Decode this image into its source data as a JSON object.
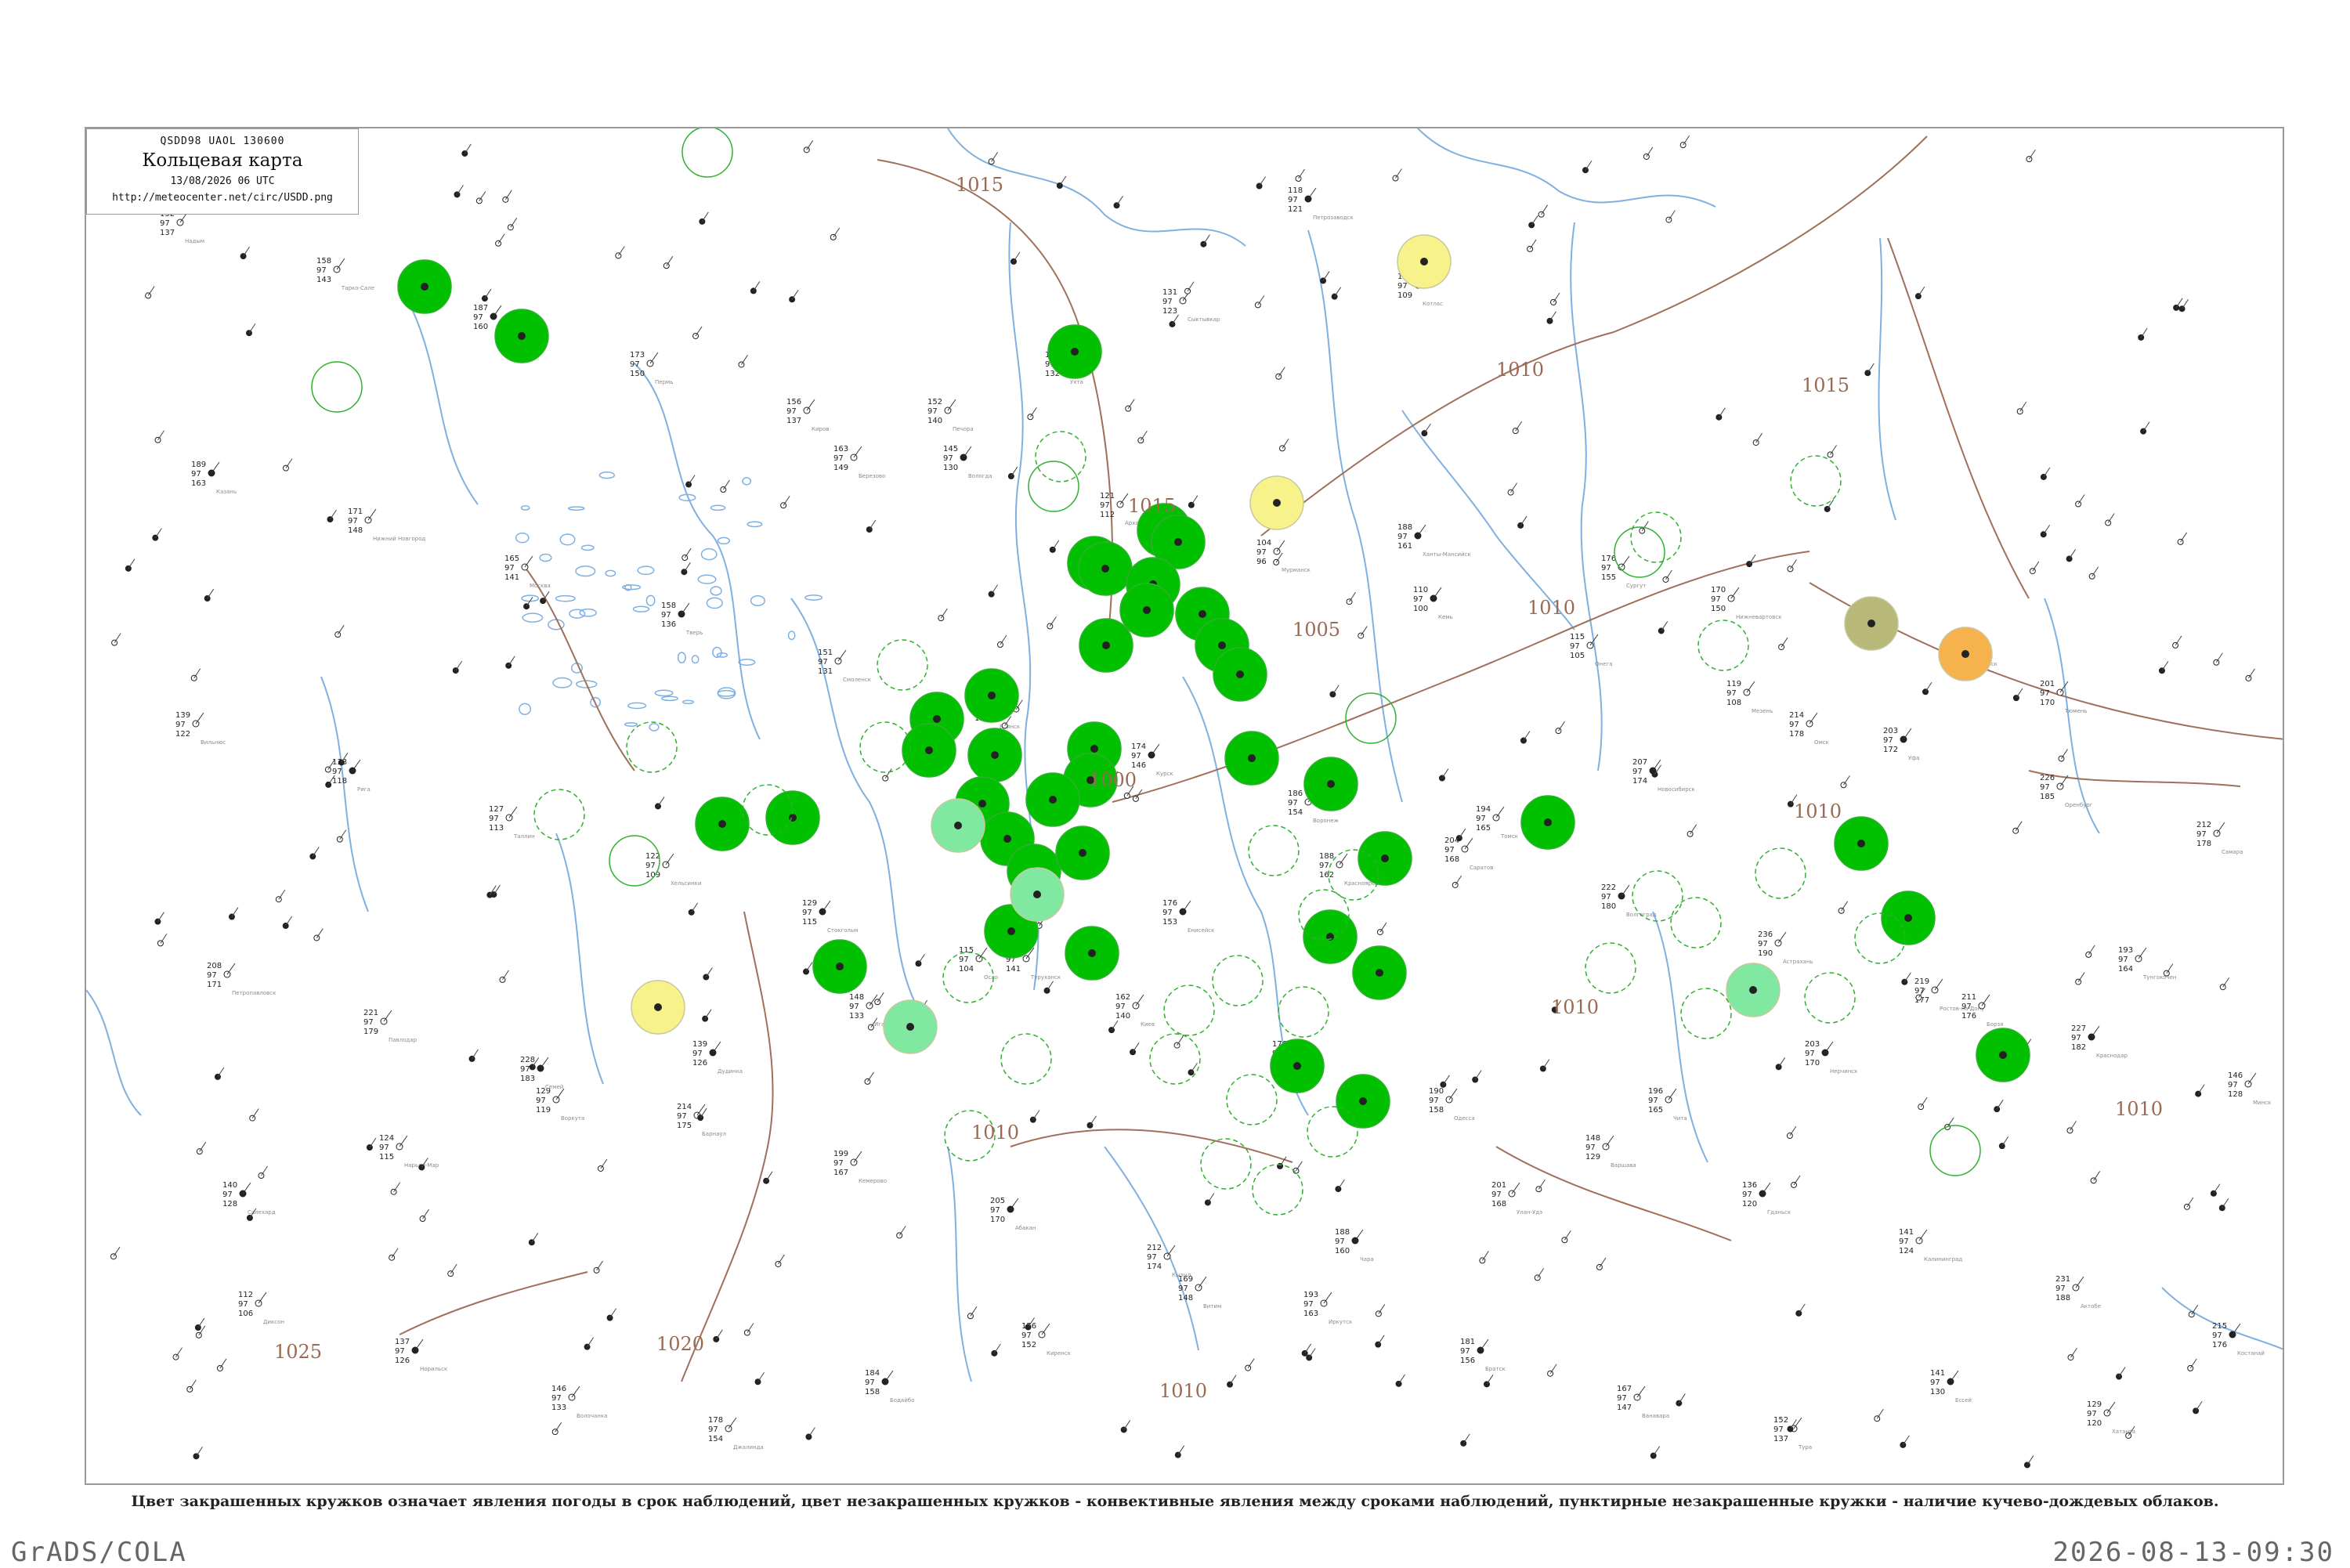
{
  "header": {
    "code": "QSDD98  UAOL  130600",
    "title": "Кольцевая карта",
    "date": "13/08/2026 06 UTC",
    "url": "http://meteocenter.net/circ/USDD.png"
  },
  "caption": "Цвет закрашенных кружков означает явления погоды в срок наблюдений, цвет незакрашенных кружков - конвективные явления между сроками наблюдений, пунктирные незакрашенные кружки - наличие кучево-дождевых облаков.",
  "footer": {
    "left": "GrADS/COLA",
    "right": "2026-08-13-09:30"
  },
  "colors": {
    "rain": "#00c000",
    "rain_light": "#80e8a0",
    "fog": "#f7f38a",
    "haze": "#b8b878",
    "dust": "#f6b24c",
    "isobar": "#a0705a",
    "river": "#7fb0e0",
    "outline": "#30b030"
  },
  "isobar_labels": [
    "1015",
    "1010",
    "1015",
    "1010",
    "1005",
    "1000",
    "1010",
    "1010",
    "1010",
    "1015",
    "1010",
    "1025",
    "1020",
    "1010"
  ],
  "stations": [
    {
      "name": "Петрозаводск",
      "values": [
        "118",
        "97",
        "121"
      ]
    },
    {
      "name": "Котлас",
      "values": [
        "127",
        "97",
        "109"
      ]
    },
    {
      "name": "Сыктывкар",
      "values": [
        "131",
        "97",
        "123"
      ]
    },
    {
      "name": "Ухта",
      "values": [
        "145",
        "97",
        "132"
      ]
    },
    {
      "name": "Печора",
      "values": [
        "152",
        "97",
        "140"
      ]
    },
    {
      "name": "Березово",
      "values": [
        "163",
        "97",
        "149"
      ]
    },
    {
      "name": "Ханты-Мансийск",
      "values": [
        "188",
        "97",
        "161"
      ]
    },
    {
      "name": "Сургут",
      "values": [
        "176",
        "97",
        "155"
      ]
    },
    {
      "name": "Нижневартовск",
      "values": [
        "170",
        "97",
        "150"
      ]
    },
    {
      "name": "Тобольск",
      "values": [
        "196",
        "97",
        "168"
      ]
    },
    {
      "name": "Тюмень",
      "values": [
        "201",
        "97",
        "170"
      ]
    },
    {
      "name": "Омск",
      "values": [
        "214",
        "97",
        "178"
      ]
    },
    {
      "name": "Новосибирск",
      "values": [
        "207",
        "97",
        "174"
      ]
    },
    {
      "name": "Томск",
      "values": [
        "194",
        "97",
        "165"
      ]
    },
    {
      "name": "Красноярск",
      "values": [
        "188",
        "97",
        "162"
      ]
    },
    {
      "name": "Енисейск",
      "values": [
        "176",
        "97",
        "153"
      ]
    },
    {
      "name": "Туруханск",
      "values": [
        "160",
        "97",
        "141"
      ]
    },
    {
      "name": "Игарка",
      "values": [
        "148",
        "97",
        "133"
      ]
    },
    {
      "name": "Дудинка",
      "values": [
        "139",
        "97",
        "126"
      ]
    },
    {
      "name": "Воркута",
      "values": [
        "129",
        "97",
        "119"
      ]
    },
    {
      "name": "Нарьян-Мар",
      "values": [
        "124",
        "97",
        "115"
      ]
    },
    {
      "name": "Салехард",
      "values": [
        "140",
        "97",
        "128"
      ]
    },
    {
      "name": "Надым",
      "values": [
        "152",
        "97",
        "137"
      ]
    },
    {
      "name": "Тарко-Сале",
      "values": [
        "158",
        "97",
        "143"
      ]
    },
    {
      "name": "Екатеринбург",
      "values": [
        "187",
        "97",
        "160"
      ]
    },
    {
      "name": "Пермь",
      "values": [
        "173",
        "97",
        "150"
      ]
    },
    {
      "name": "Киров",
      "values": [
        "156",
        "97",
        "137"
      ]
    },
    {
      "name": "Вологда",
      "values": [
        "145",
        "97",
        "130"
      ]
    },
    {
      "name": "Архангельск",
      "values": [
        "121",
        "97",
        "112"
      ]
    },
    {
      "name": "Мурманск",
      "values": [
        "104",
        "97",
        "96"
      ]
    },
    {
      "name": "Кемь",
      "values": [
        "110",
        "97",
        "100"
      ]
    },
    {
      "name": "Онега",
      "values": [
        "115",
        "97",
        "105"
      ]
    },
    {
      "name": "Мезень",
      "values": [
        "119",
        "97",
        "108"
      ]
    },
    {
      "name": "Уфа",
      "values": [
        "203",
        "97",
        "172"
      ]
    },
    {
      "name": "Оренбург",
      "values": [
        "226",
        "97",
        "185"
      ]
    },
    {
      "name": "Самара",
      "values": [
        "212",
        "97",
        "178"
      ]
    },
    {
      "name": "Казань",
      "values": [
        "189",
        "97",
        "163"
      ]
    },
    {
      "name": "Нижний Новгород",
      "values": [
        "171",
        "97",
        "148"
      ]
    },
    {
      "name": "Москва",
      "values": [
        "165",
        "97",
        "141"
      ]
    },
    {
      "name": "Тверь",
      "values": [
        "158",
        "97",
        "136"
      ]
    },
    {
      "name": "Смоленск",
      "values": [
        "151",
        "97",
        "131"
      ]
    },
    {
      "name": "Брянск",
      "values": [
        "163",
        "97",
        "139"
      ]
    },
    {
      "name": "Курск",
      "values": [
        "174",
        "97",
        "146"
      ]
    },
    {
      "name": "Воронеж",
      "values": [
        "186",
        "97",
        "154"
      ]
    },
    {
      "name": "Саратов",
      "values": [
        "204",
        "97",
        "168"
      ]
    },
    {
      "name": "Волгоград",
      "values": [
        "222",
        "97",
        "180"
      ]
    },
    {
      "name": "Астрахань",
      "values": [
        "236",
        "97",
        "190"
      ]
    },
    {
      "name": "Ростов-на-Дону",
      "values": [
        "219",
        "97",
        "177"
      ]
    },
    {
      "name": "Краснодар",
      "values": [
        "227",
        "97",
        "182"
      ]
    },
    {
      "name": "Минск",
      "values": [
        "146",
        "97",
        "128"
      ]
    },
    {
      "name": "Вильнюс",
      "values": [
        "139",
        "97",
        "122"
      ]
    },
    {
      "name": "Рига",
      "values": [
        "133",
        "97",
        "118"
      ]
    },
    {
      "name": "Таллин",
      "values": [
        "127",
        "97",
        "113"
      ]
    },
    {
      "name": "Хельсинки",
      "values": [
        "122",
        "97",
        "109"
      ]
    },
    {
      "name": "Стокгольм",
      "values": [
        "129",
        "97",
        "115"
      ]
    },
    {
      "name": "Осло",
      "values": [
        "115",
        "97",
        "104"
      ]
    },
    {
      "name": "Киев",
      "values": [
        "162",
        "97",
        "140"
      ]
    },
    {
      "name": "Харьков",
      "values": [
        "176",
        "97",
        "148"
      ]
    },
    {
      "name": "Одесса",
      "values": [
        "190",
        "97",
        "158"
      ]
    },
    {
      "name": "Варшава",
      "values": [
        "148",
        "97",
        "129"
      ]
    },
    {
      "name": "Гданьск",
      "values": [
        "136",
        "97",
        "120"
      ]
    },
    {
      "name": "Калининград",
      "values": [
        "141",
        "97",
        "124"
      ]
    },
    {
      "name": "Актобе",
      "values": [
        "231",
        "97",
        "188"
      ]
    },
    {
      "name": "Костанай",
      "values": [
        "215",
        "97",
        "176"
      ]
    },
    {
      "name": "Петропавловск",
      "values": [
        "208",
        "97",
        "171"
      ]
    },
    {
      "name": "Павлодар",
      "values": [
        "221",
        "97",
        "179"
      ]
    },
    {
      "name": "Семей",
      "values": [
        "228",
        "97",
        "183"
      ]
    },
    {
      "name": "Барнаул",
      "values": [
        "214",
        "97",
        "175"
      ]
    },
    {
      "name": "Кемерово",
      "values": [
        "199",
        "97",
        "167"
      ]
    },
    {
      "name": "Абакан",
      "values": [
        "205",
        "97",
        "170"
      ]
    },
    {
      "name": "Кызыл",
      "values": [
        "212",
        "97",
        "174"
      ]
    },
    {
      "name": "Иркутск",
      "values": [
        "193",
        "97",
        "163"
      ]
    },
    {
      "name": "Братск",
      "values": [
        "181",
        "97",
        "156"
      ]
    },
    {
      "name": "Ванавара",
      "values": [
        "167",
        "97",
        "147"
      ]
    },
    {
      "name": "Тура",
      "values": [
        "152",
        "97",
        "137"
      ]
    },
    {
      "name": "Ессей",
      "values": [
        "141",
        "97",
        "130"
      ]
    },
    {
      "name": "Хатанга",
      "values": [
        "129",
        "97",
        "120"
      ]
    },
    {
      "name": "Диксон",
      "values": [
        "112",
        "97",
        "106"
      ]
    },
    {
      "name": "Норильск",
      "values": [
        "137",
        "97",
        "126"
      ]
    },
    {
      "name": "Волочанка",
      "values": [
        "146",
        "97",
        "133"
      ]
    },
    {
      "name": "Джалинда",
      "values": [
        "178",
        "97",
        "154"
      ]
    },
    {
      "name": "Бодайбо",
      "values": [
        "184",
        "97",
        "158"
      ]
    },
    {
      "name": "Киренск",
      "values": [
        "176",
        "97",
        "152"
      ]
    },
    {
      "name": "Витим",
      "values": [
        "169",
        "97",
        "148"
      ]
    },
    {
      "name": "Чара",
      "values": [
        "188",
        "97",
        "160"
      ]
    },
    {
      "name": "Улан-Удэ",
      "values": [
        "201",
        "97",
        "168"
      ]
    },
    {
      "name": "Чита",
      "values": [
        "196",
        "97",
        "165"
      ]
    },
    {
      "name": "Нерчинск",
      "values": [
        "203",
        "97",
        "170"
      ]
    },
    {
      "name": "Борзя",
      "values": [
        "211",
        "97",
        "176"
      ]
    },
    {
      "name": "Тунгокочен",
      "values": [
        "193",
        "97",
        "164"
      ]
    }
  ]
}
